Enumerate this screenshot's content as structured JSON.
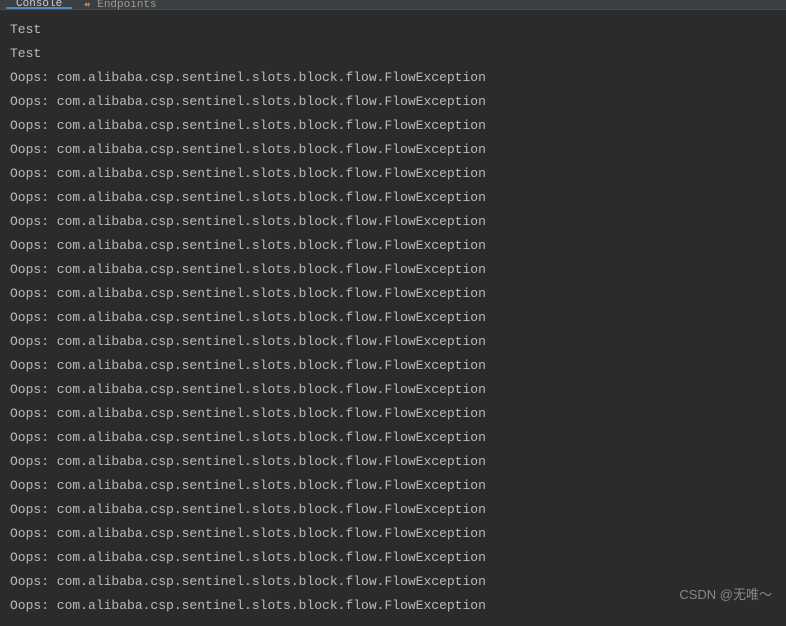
{
  "tabs": {
    "console": "Console",
    "endpoints": "Endpoints"
  },
  "console": {
    "lines": [
      "Test",
      "Test",
      "Oops: com.alibaba.csp.sentinel.slots.block.flow.FlowException",
      "Oops: com.alibaba.csp.sentinel.slots.block.flow.FlowException",
      "Oops: com.alibaba.csp.sentinel.slots.block.flow.FlowException",
      "Oops: com.alibaba.csp.sentinel.slots.block.flow.FlowException",
      "Oops: com.alibaba.csp.sentinel.slots.block.flow.FlowException",
      "Oops: com.alibaba.csp.sentinel.slots.block.flow.FlowException",
      "Oops: com.alibaba.csp.sentinel.slots.block.flow.FlowException",
      "Oops: com.alibaba.csp.sentinel.slots.block.flow.FlowException",
      "Oops: com.alibaba.csp.sentinel.slots.block.flow.FlowException",
      "Oops: com.alibaba.csp.sentinel.slots.block.flow.FlowException",
      "Oops: com.alibaba.csp.sentinel.slots.block.flow.FlowException",
      "Oops: com.alibaba.csp.sentinel.slots.block.flow.FlowException",
      "Oops: com.alibaba.csp.sentinel.slots.block.flow.FlowException",
      "Oops: com.alibaba.csp.sentinel.slots.block.flow.FlowException",
      "Oops: com.alibaba.csp.sentinel.slots.block.flow.FlowException",
      "Oops: com.alibaba.csp.sentinel.slots.block.flow.FlowException",
      "Oops: com.alibaba.csp.sentinel.slots.block.flow.FlowException",
      "Oops: com.alibaba.csp.sentinel.slots.block.flow.FlowException",
      "Oops: com.alibaba.csp.sentinel.slots.block.flow.FlowException",
      "Oops: com.alibaba.csp.sentinel.slots.block.flow.FlowException",
      "Oops: com.alibaba.csp.sentinel.slots.block.flow.FlowException",
      "Oops: com.alibaba.csp.sentinel.slots.block.flow.FlowException",
      "Oops: com.alibaba.csp.sentinel.slots.block.flow.FlowException"
    ]
  },
  "watermark": "CSDN @无唯～"
}
